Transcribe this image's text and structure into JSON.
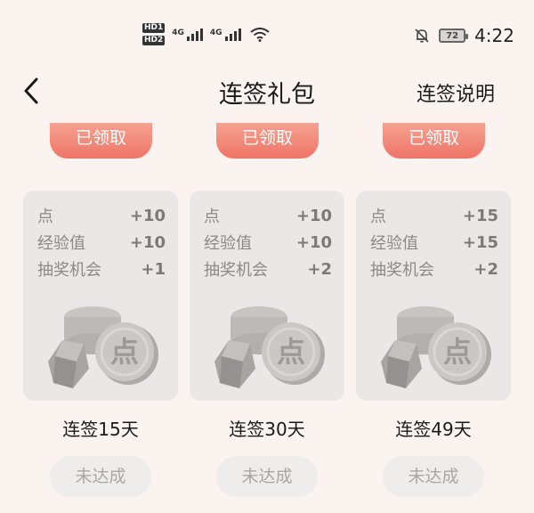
{
  "status": {
    "hd1": "HD1",
    "hd2": "HD2",
    "net1": "4G",
    "net2": "4G",
    "battery": "72",
    "time": "4:22",
    "icons": [
      "signal-icon",
      "wifi-icon",
      "mute-bell-icon",
      "battery-icon"
    ]
  },
  "header": {
    "back_icon": "chevron-left-icon",
    "title": "连签礼包",
    "help_label": "连签说明"
  },
  "rewards": [
    {
      "claim_label": "已领取",
      "items": [
        {
          "label": "点",
          "value": "+10"
        },
        {
          "label": "经验值",
          "value": "+10"
        },
        {
          "label": "抽奖机会",
          "value": "+1"
        }
      ],
      "days_label": "连签15天",
      "status_label": "未达成"
    },
    {
      "claim_label": "已领取",
      "items": [
        {
          "label": "点",
          "value": "+10"
        },
        {
          "label": "经验值",
          "value": "+10"
        },
        {
          "label": "抽奖机会",
          "value": "+2"
        }
      ],
      "days_label": "连签30天",
      "status_label": "未达成"
    },
    {
      "claim_label": "已领取",
      "items": [
        {
          "label": "点",
          "value": "+15"
        },
        {
          "label": "经验值",
          "value": "+15"
        },
        {
          "label": "抽奖机会",
          "value": "+2"
        }
      ],
      "days_label": "连签49天",
      "status_label": "未达成"
    }
  ],
  "colors": {
    "background": "#fbf3ef",
    "claimed_button": "#ee7467",
    "card": "#eae7e6",
    "pending_button": "#efedec"
  }
}
